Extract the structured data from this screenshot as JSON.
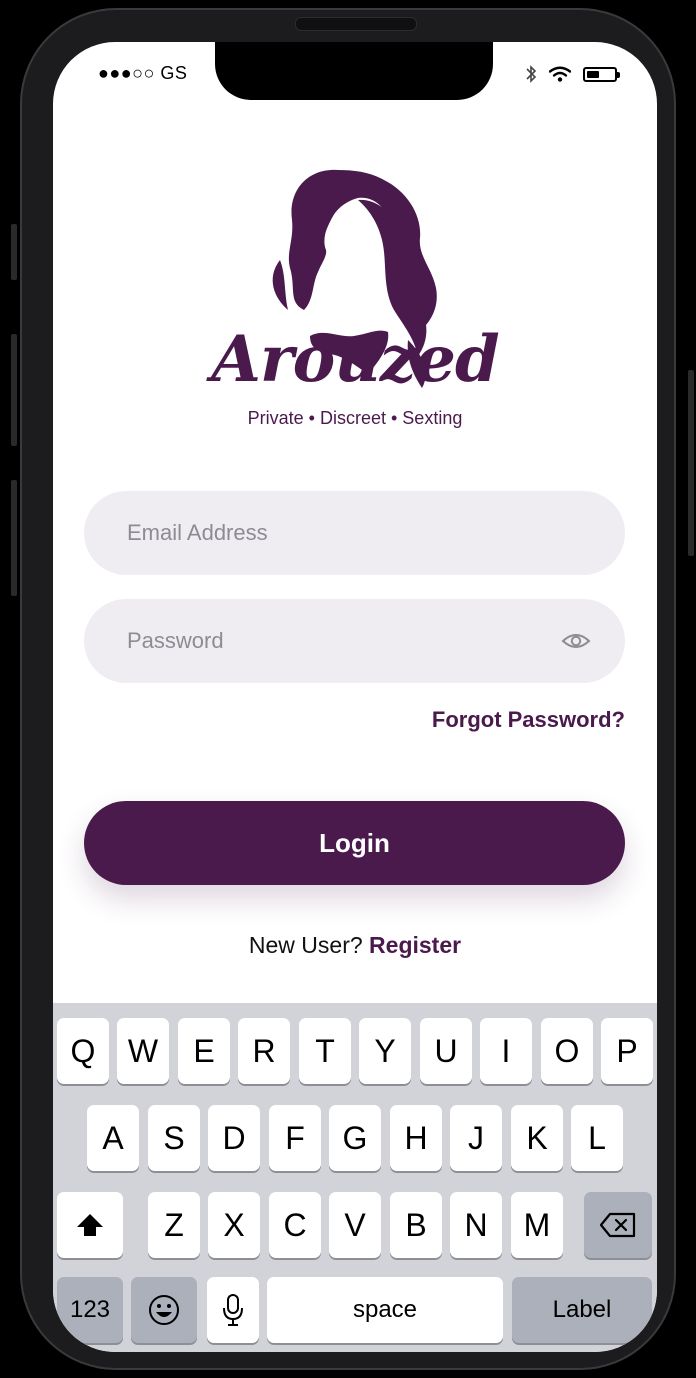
{
  "status_bar": {
    "carrier": "●●●○○ GS",
    "battery_level": 0.45,
    "icons": [
      "bluetooth-icon",
      "wifi-icon",
      "battery-icon"
    ]
  },
  "brand": {
    "name": "Arouzed",
    "tagline": "Private • Discreet • Sexting",
    "color": "#4a1a4c"
  },
  "form": {
    "email_placeholder": "Email Address",
    "password_placeholder": "Password",
    "forgot_password": "Forgot Password?",
    "login_label": "Login",
    "new_user_text": "New User?",
    "register_label": "Register"
  },
  "keyboard": {
    "row1": [
      "Q",
      "W",
      "E",
      "R",
      "T",
      "Y",
      "U",
      "I",
      "O",
      "P"
    ],
    "row2": [
      "A",
      "S",
      "D",
      "F",
      "G",
      "H",
      "J",
      "K",
      "L"
    ],
    "row3": [
      "Z",
      "X",
      "C",
      "V",
      "B",
      "N",
      "M"
    ],
    "numbers_key": "123",
    "space_key": "space",
    "return_key": "Label"
  }
}
